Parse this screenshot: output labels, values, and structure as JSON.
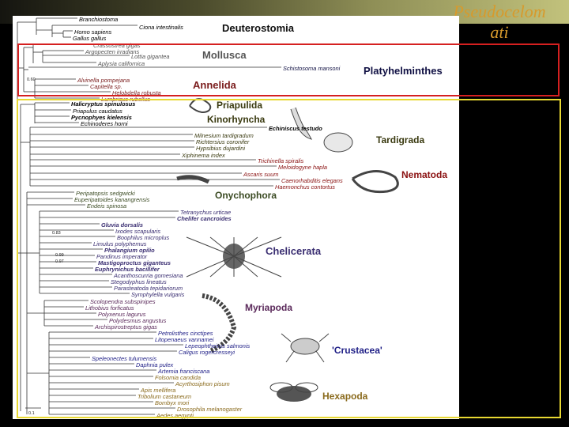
{
  "slide": {
    "title": "Pseudocelom\nati",
    "title_color": "#d79a2c"
  },
  "colors": {
    "black": "#000000",
    "deutero": "#111111",
    "mollusca": "#555555",
    "annelida": "#7a1c1c",
    "platy": "#111144",
    "ecdyso": "#3a3a10",
    "nematoda": "#8a1010",
    "onycho": "#3a4a22",
    "chelic": "#3b2f72",
    "myriapoda": "#5b2a5b",
    "crust": "#1e1e86",
    "hexapoda": "#8a6a1c",
    "red_box": "#d52020",
    "yellow_box": "#e8d832"
  },
  "supergroups": {
    "deuterostomia": "Deuterostomia",
    "mollusca": "Mollusca",
    "annelida": "Annelida",
    "platyhelminthes": "Platyhelminthes",
    "priapulida": "Priapulida",
    "kinorhyncha": "Kinorhyncha",
    "tardigrada": "Tardigrada",
    "nematoda": "Nematoda",
    "onychophora": "Onychophora",
    "chelicerata": "Chelicerata",
    "myriapoda": "Myriapoda",
    "crustacea": "'Crustacea'",
    "hexapoda": "Hexapoda"
  },
  "taxa": [
    "Branchiostoma",
    "Ciona intestinalis",
    "Homo sapiens",
    "Gallus gallus",
    "Crassostrea gigas",
    "Argopecten irradians",
    "Lottia gigantea",
    "Aplysia californica",
    "Schistosoma mansoni",
    "Alvinella pompejana",
    "Capitella sp.",
    "Helobdella robusta",
    "Lumbricus rubellus",
    "Halicryptus spinulosus",
    "Priapulus caudatus",
    "Pycnophyes kielensis",
    "Echinoderes horni",
    "Echiniscus testudo",
    "Milnesium tardigradum",
    "Richtersius coronifer",
    "Hypsibius dujardini",
    "Xiphinema index",
    "Trichinella spiralis",
    "Meloidogyne hapla",
    "Ascaris suum",
    "Caenorhabditis elegans",
    "Haemonchus contortus",
    "Peripatopsis sedgwicki",
    "Euperipatoides kanangrensis",
    "Endeis spinosa",
    "Tetranychus urticae",
    "Chelifer cancroides",
    "Gluvia dorsalis",
    "Ixodes scapularis",
    "Boophilus microplus",
    "Limulus polyphemus",
    "Phalangium opilio",
    "Pandinus imperator",
    "Mastigoproctus giganteus",
    "Euphrynichus bacillifer",
    "Acanthoscurria gomesiana",
    "Stegodyphus lineatus",
    "Parasteatoda tepidariorum",
    "Symphylella vulgaris",
    "Scolopendra subspinipes",
    "Lithobius forficatus",
    "Polyxenus lagurus",
    "Polydesmus angustus",
    "Archispirostreptus gigas",
    "Petrolisthes cinctipes",
    "Litopenaeus vannamei",
    "Lepeophtheirus salmonis",
    "Caligus rogercresseyi",
    "Speleonectes tulumensis",
    "Daphnia pulex",
    "Artemia franciscana",
    "Folsomia candida",
    "Acyrthosiphon pisum",
    "Apis mellifera",
    "Tribolium castaneum",
    "Bombyx mori",
    "Drosophila melanogaster",
    "Aedes aegypti"
  ],
  "bootstrap": [
    "0.60",
    "0.83",
    "0.99",
    "0.97"
  ],
  "scale": "0.1"
}
